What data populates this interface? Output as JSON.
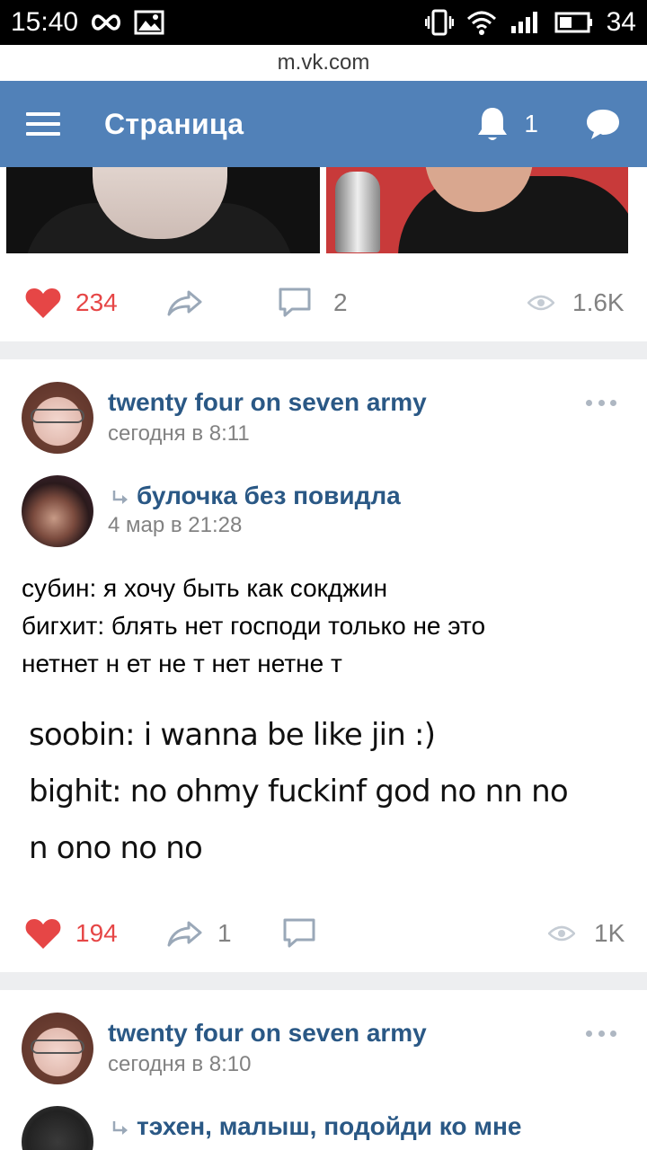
{
  "status_bar": {
    "time": "15:40",
    "battery": "34",
    "icons": [
      "infinity-icon",
      "image-icon",
      "vibrate-icon",
      "wifi-icon",
      "signal-icon",
      "battery-icon"
    ]
  },
  "browser": {
    "url": "m.vk.com"
  },
  "header": {
    "title": "Страница",
    "notifications_count": "1",
    "icons": [
      "menu-icon",
      "bell-icon",
      "messages-icon"
    ],
    "background": "#5181b8"
  },
  "posts": [
    {
      "likes": "234",
      "shares": "",
      "comments": "2",
      "views": "1.6K"
    },
    {
      "author": "twenty four on seven army",
      "date": "сегодня в 8:11",
      "repost_author": "булочка без повидла",
      "repost_date": "4 мар в 21:28",
      "text_lines": [
        "субин: я хочу быть как сокджин",
        "бигхит: блять нет господи только не это",
        "нетнет н ет не т нет нетне т"
      ],
      "image_text_lines": [
        "soobin: i wanna be like jin :)",
        "bighit: no ohmy fuckinf  god no nn no",
        "n ono no no"
      ],
      "likes": "194",
      "shares": "1",
      "comments": "",
      "views": "1K"
    },
    {
      "author": "twenty four on seven army",
      "date": "сегодня в 8:10",
      "repost_author": "тэхен, малыш, подойди ко мне"
    }
  ],
  "colors": {
    "like": "#e64646",
    "link": "#2a5885",
    "muted": "#828282",
    "divider": "#edeef0"
  }
}
